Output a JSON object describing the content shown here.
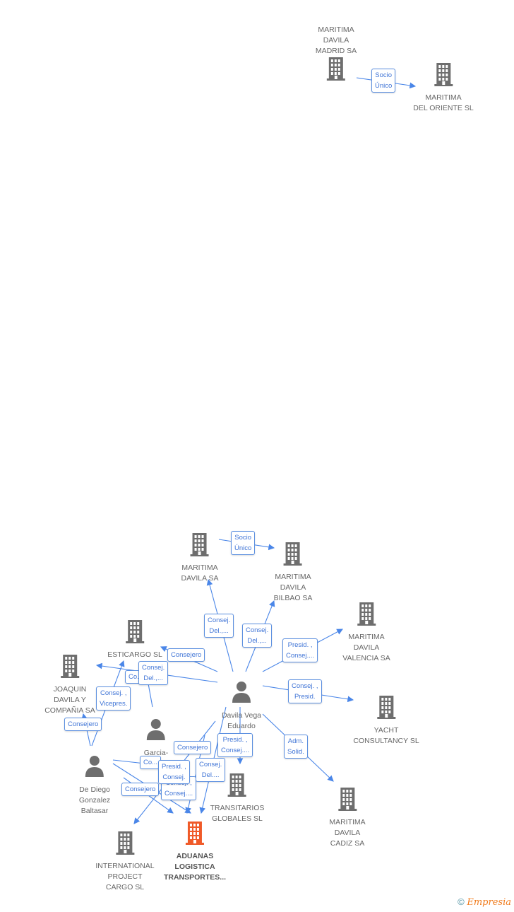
{
  "colors": {
    "node": "#6e6e6e",
    "main_node": "#f05a28",
    "edge": "#4a86e8"
  },
  "nodes": [
    {
      "id": "madrid",
      "type": "company",
      "label": "MARITIMA\nDAVILA\nMADRID SA"
    },
    {
      "id": "oriente",
      "type": "company",
      "label": "MARITIMA\nDEL ORIENTE SL"
    },
    {
      "id": "davila_sa",
      "type": "company",
      "label": "MARITIMA\nDAVILA SA"
    },
    {
      "id": "bilbao",
      "type": "company",
      "label": "MARITIMA\nDAVILA\nBILBAO SA"
    },
    {
      "id": "valencia",
      "type": "company",
      "label": "MARITIMA\nDAVILA\nVALENCIA SA"
    },
    {
      "id": "esticargo",
      "type": "company",
      "label": "ESTICARGO SL"
    },
    {
      "id": "joaquin",
      "type": "company",
      "label": "JOAQUIN\nDAVILA Y\nCOMPAÑIA SA"
    },
    {
      "id": "eduardo",
      "type": "person",
      "label": "Davila Vega\nEduardo"
    },
    {
      "id": "yacht",
      "type": "company",
      "label": "YACHT\nCONSULTANCY SL"
    },
    {
      "id": "garcia",
      "type": "person",
      "label": "Garcia-\nBras..."
    },
    {
      "id": "baltasar",
      "type": "person",
      "label": "De Diego\nGonzalez\nBaltasar"
    },
    {
      "id": "transitarios",
      "type": "company",
      "label": "TRANSITARIOS\nGLOBALES SL"
    },
    {
      "id": "cadiz",
      "type": "company",
      "label": "MARITIMA\nDAVILA\nCADIZ SA"
    },
    {
      "id": "ipc",
      "type": "company",
      "label": "INTERNATIONAL\nPROJECT\nCARGO SL"
    },
    {
      "id": "aduanas",
      "type": "company",
      "main": true,
      "label": "ADUANAS\nLOGISTICA\nTRANSPORTES..."
    }
  ],
  "edge_labels": [
    "Socio\nÚnico",
    "Socio\nÚnico",
    "Consej.\nDel.,...",
    "Consej.\nDel.,...",
    "Presid. ,\nConsej....",
    "Consejero",
    "Co...",
    "Consej.\nDel.,...",
    "Consej. ,\nPresid.",
    "Consej. ,\nVicepres.",
    "Consejero",
    "Adm.\nSolid.",
    "Consejero",
    "Presid. ,\nConsej....",
    "Co...",
    "Consej. ,\nConsej....",
    "Consejero",
    "Presid. ,\nConsej.",
    "Consej.\nDel...."
  ],
  "footer": {
    "copyright": "©",
    "brand": "Empresia"
  }
}
